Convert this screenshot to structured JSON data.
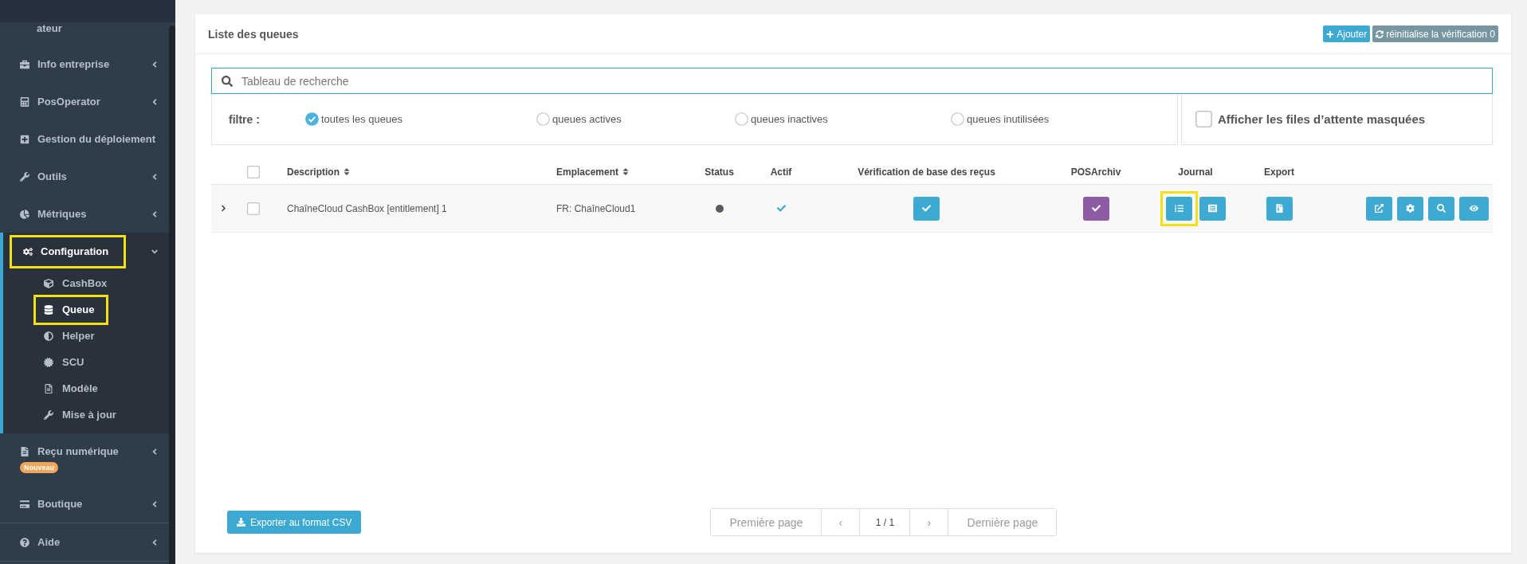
{
  "sidebar": {
    "partial_item": {
      "label": "ateur"
    },
    "items": [
      {
        "label": "Info entreprise",
        "expandable": true,
        "expanded": false,
        "selected": false,
        "highlighted": false
      },
      {
        "label": "PosOperator",
        "expandable": true,
        "expanded": false,
        "selected": false,
        "highlighted": false
      },
      {
        "label": "Gestion du déploiement",
        "expandable": false,
        "expanded": false,
        "selected": false,
        "highlighted": false
      },
      {
        "label": "Outils",
        "expandable": true,
        "expanded": false,
        "selected": false,
        "highlighted": false
      },
      {
        "label": "Métriques",
        "expandable": true,
        "expanded": false,
        "selected": false,
        "highlighted": false
      },
      {
        "label": "Configuration",
        "expandable": true,
        "expanded": true,
        "selected": true,
        "highlighted": true,
        "children": [
          {
            "label": "CashBox",
            "selected": false,
            "highlighted": false
          },
          {
            "label": "Queue",
            "selected": true,
            "highlighted": true
          },
          {
            "label": "Helper",
            "selected": false,
            "highlighted": false
          },
          {
            "label": "SCU",
            "selected": false,
            "highlighted": false
          },
          {
            "label": "Modèle",
            "selected": false,
            "highlighted": false
          },
          {
            "label": "Mise à jour",
            "selected": false,
            "highlighted": false
          }
        ]
      },
      {
        "label": "Reçu numérique",
        "expandable": true,
        "expanded": false,
        "selected": false,
        "highlighted": false,
        "badge": "Nouveau"
      },
      {
        "label": "Boutique",
        "expandable": true,
        "expanded": false,
        "selected": false,
        "highlighted": false
      },
      {
        "label": "Aide",
        "expandable": true,
        "expanded": false,
        "selected": false,
        "highlighted": false
      }
    ]
  },
  "panel": {
    "title": "Liste des queues",
    "buttons": [
      {
        "label": "Ajouter",
        "kind": "add"
      },
      {
        "label": "réinitialise la vérification 0",
        "kind": "reset"
      }
    ]
  },
  "search": {
    "placeholder": "Tableau de recherche"
  },
  "filter": {
    "label": "filtre :",
    "options": [
      {
        "label": "toutes les queues",
        "selected": true
      },
      {
        "label": "queues actives",
        "selected": false
      },
      {
        "label": "queues inactives",
        "selected": false
      },
      {
        "label": "queues inutilisées",
        "selected": false
      }
    ]
  },
  "hidden_queues_toggle": {
    "label": "Afficher les files d’attente masquées",
    "checked": false
  },
  "table": {
    "select_all_checked": false,
    "columns": [
      {
        "label": "Description",
        "sortable": true
      },
      {
        "label": "Emplacement",
        "sortable": true
      },
      {
        "label": "Status",
        "sortable": false
      },
      {
        "label": "Actif",
        "sortable": false
      },
      {
        "label": "Vérification de base des reçus",
        "sortable": false
      },
      {
        "label": "POSArchiv",
        "sortable": false
      },
      {
        "label": "Journal",
        "sortable": false
      },
      {
        "label": "Export",
        "sortable": false
      }
    ],
    "rows": [
      {
        "expanded": false,
        "checked": false,
        "description": "ChaîneCloud CashBox [entitlement] 1",
        "location": "FR: ChaîneCloud1",
        "status": {
          "color": "#555b62"
        },
        "active": true,
        "journal_buttons": [
          {
            "highlighted": true
          },
          {
            "highlighted": false
          }
        ]
      }
    ]
  },
  "export_button": {
    "label": "Exporter au format CSV"
  },
  "pagination": [
    {
      "label": "Première page",
      "disabled": true
    },
    {
      "label": "‹",
      "disabled": true
    },
    {
      "label": "1 / 1",
      "disabled": false
    },
    {
      "label": "›",
      "disabled": true
    },
    {
      "label": "Dernière page",
      "disabled": true
    }
  ]
}
